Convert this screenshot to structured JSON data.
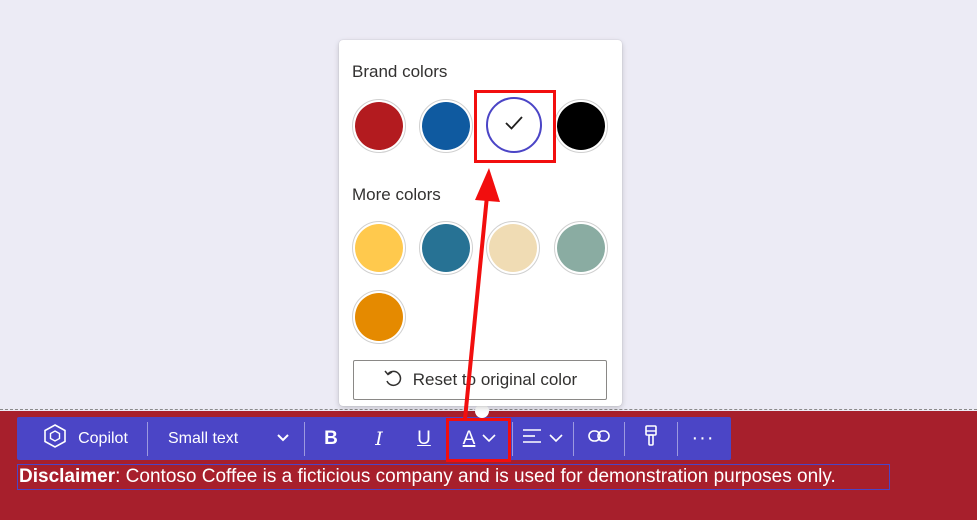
{
  "popup": {
    "brand_title": "Brand colors",
    "more_title": "More colors",
    "brand_colors": [
      "#b31b1f",
      "#0f5aa0",
      "#ffffff",
      "#000000"
    ],
    "more_colors": [
      "#ffc94d",
      "#277294",
      "#f0dcb4",
      "#8aaca2",
      "#e58a00"
    ],
    "selected_check": "✓",
    "reset_label": "Reset to original color"
  },
  "toolbar": {
    "copilot_label": "Copilot",
    "font_size_value": "Small text",
    "bold_label": "B",
    "italic_label": "I",
    "underline_label": "U",
    "font_color_label": "A",
    "more_label": "···"
  },
  "disclaimer": {
    "bold_part": "Disclaimer",
    "rest": ": Contoso Coffee is a ficticious company and is used for demonstration purposes only."
  },
  "colors": {
    "accent": "#4b45c6",
    "footer": "#a71f2c",
    "highlight": "#f20e0e"
  }
}
